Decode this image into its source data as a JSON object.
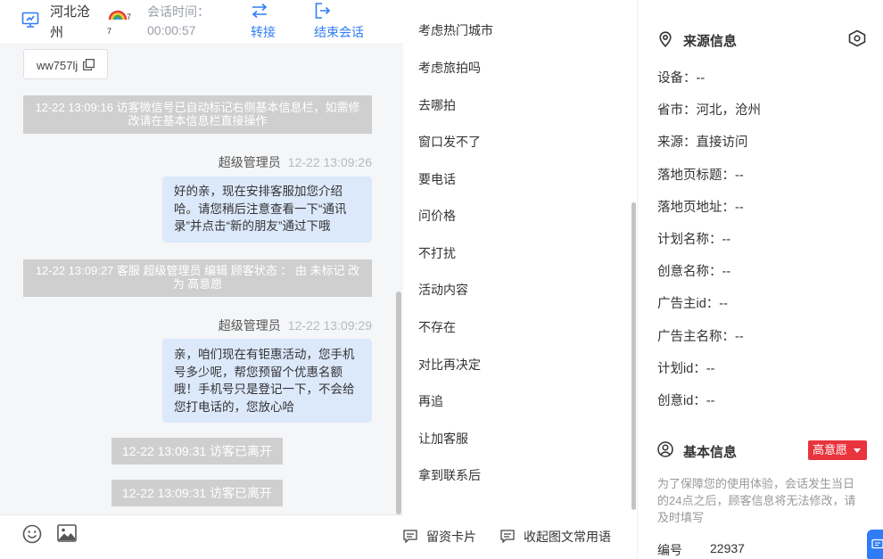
{
  "header": {
    "location": "河北沧州",
    "rainbow_sup": "7",
    "rainbow_sub": "7",
    "session_time_label": "会话时间：",
    "session_time_value": "00:00:57",
    "transfer_label": "转接",
    "end_session_label": "结束会话"
  },
  "chat": {
    "wechat_chip": "ww757lj",
    "system_note_1": "12-22 13:09:16 访客微信号已自动标记右侧基本信息栏，如需修改请在基本信息栏直接操作",
    "message_1": {
      "sender": "超级管理员",
      "time": "12-22 13:09:26",
      "text": "好的亲，现在安排客服加您介绍哈。请您稍后注意查看一下“通讯录”并点击“新的朋友”通过下哦"
    },
    "system_note_2": "12-22 13:09:27 客服 超级管理员 编辑 顾客状态 ： 由 未标记 改为 高意愿",
    "message_2": {
      "sender": "超级管理员",
      "time": "12-22 13:09:29",
      "text": "亲，咱们现在有钜惠活动，您手机号多少呢，帮您预留个优惠名额哦！手机号只是登记一下，不会给您打电话的，您放心哈"
    },
    "leave_1": "12-22 13:09:31 访客已离开",
    "leave_2": "12-22 13:09:31 访客已离开"
  },
  "quick_replies": {
    "items": [
      "考虑热门城市",
      "考虑旅拍吗",
      "去哪拍",
      "窗口发不了",
      "要电话",
      "问价格",
      "不打扰",
      "活动内容",
      "不存在",
      "对比再决定",
      "再追",
      "让加客服",
      "拿到联系后"
    ],
    "footer_card_label": "留资卡片",
    "footer_collapse_label": "收起图文常用语"
  },
  "source_info": {
    "title": "来源信息",
    "rows": [
      "设备：--",
      "省市：河北，沧州",
      "来源：直接访问",
      "落地页标题：--",
      "落地页地址：--",
      "计划名称：--",
      "创意名称：--",
      "广告主id：--",
      "广告主名称：--",
      "计划id：--",
      "创意id：--"
    ]
  },
  "basic_info": {
    "title": "基本信息",
    "badge": "高意愿",
    "note": "为了保障您的使用体验，会话发生当日的24点之后，顾客信息将无法修改，请及时填写",
    "id_label": "编号",
    "id_value": "22937"
  },
  "colors": {
    "accent": "#2f7cf6",
    "badge_red": "#e8343c",
    "bubble_blue": "#dce9fb",
    "system_gray": "#cfcfcf"
  }
}
